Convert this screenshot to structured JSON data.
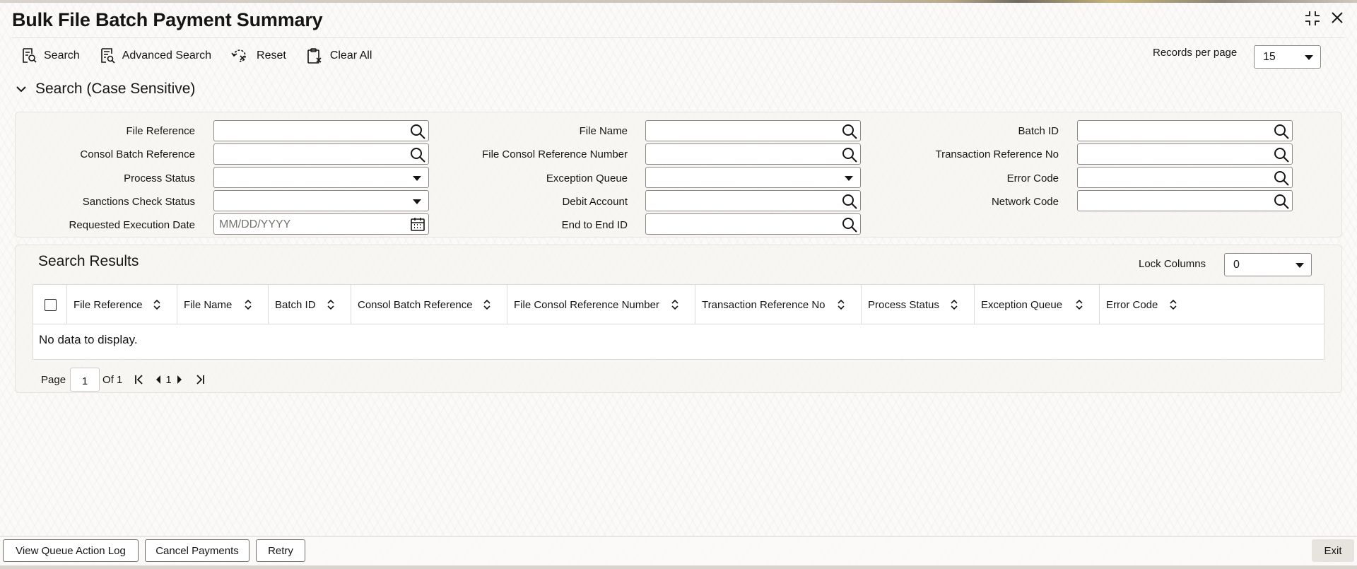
{
  "header": {
    "title": "Bulk File Batch Payment Summary"
  },
  "toolbar": {
    "search_label": "Search",
    "advanced_search_label": "Advanced Search",
    "reset_label": "Reset",
    "clear_all_label": "Clear All",
    "records_per_page_label": "Records per page",
    "records_per_page_value": "15"
  },
  "search_section": {
    "title": "Search (Case Sensitive)",
    "fields": {
      "file_reference": "File Reference",
      "consol_batch_reference": "Consol Batch Reference",
      "process_status": "Process Status",
      "sanctions_check_status": "Sanctions Check Status",
      "requested_execution_date": "Requested Execution Date",
      "requested_execution_date_placeholder": "MM/DD/YYYY",
      "file_name": "File Name",
      "file_consol_reference_number": "File Consol Reference Number",
      "exception_queue": "Exception Queue",
      "debit_account": "Debit Account",
      "end_to_end_id": "End to End ID",
      "batch_id": "Batch ID",
      "transaction_reference_no": "Transaction Reference No",
      "error_code": "Error Code",
      "network_code": "Network Code"
    }
  },
  "results": {
    "title": "Search Results",
    "lock_columns_label": "Lock Columns",
    "lock_columns_value": "0",
    "columns": [
      "File Reference",
      "File Name",
      "Batch ID",
      "Consol Batch Reference",
      "File Consol Reference Number",
      "Transaction Reference No",
      "Process Status",
      "Exception Queue",
      "Error Code"
    ],
    "empty_message": "No data to display."
  },
  "pagination": {
    "page_label": "Page",
    "current_page": "1",
    "of_label": "Of 1",
    "page_number": "1"
  },
  "footer": {
    "view_queue_action_log": "View Queue Action Log",
    "cancel_payments": "Cancel Payments",
    "retry": "Retry",
    "exit": "Exit"
  }
}
